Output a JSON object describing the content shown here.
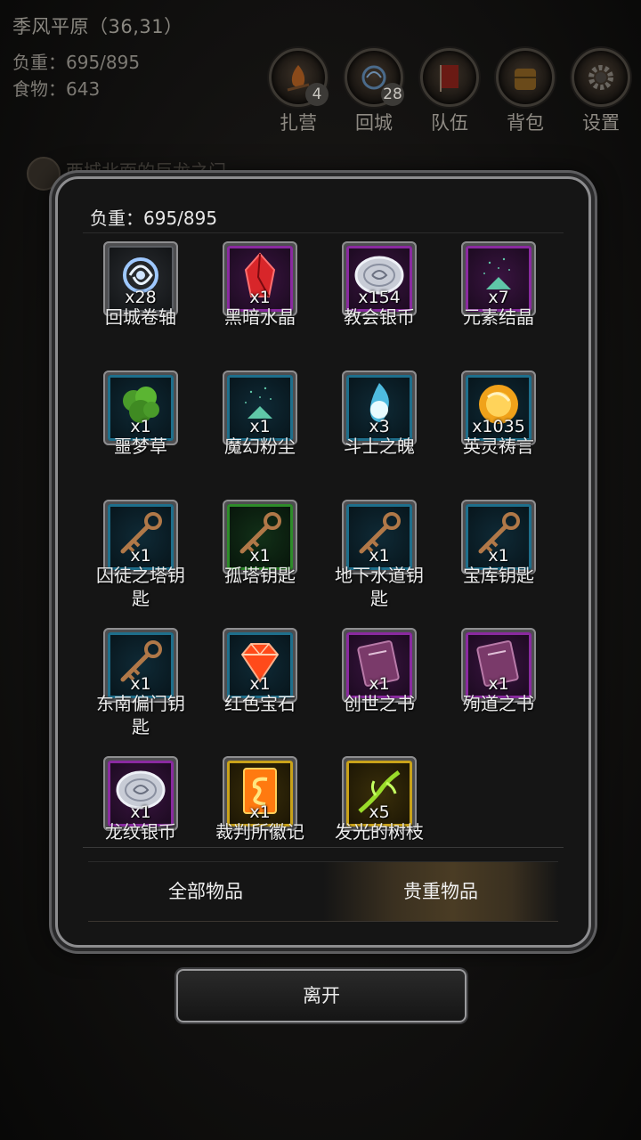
{
  "hud": {
    "location": "季风平原（36,31）",
    "load": "负重：695/895",
    "food": "食物：643",
    "buttons": [
      {
        "label": "扎营",
        "badge": "4",
        "icon": "campfire-icon"
      },
      {
        "label": "回城",
        "badge": "28",
        "icon": "portal-icon"
      },
      {
        "label": "队伍",
        "badge": "",
        "icon": "team-banner-icon"
      },
      {
        "label": "背包",
        "badge": "",
        "icon": "backpack-icon"
      },
      {
        "label": "设置",
        "badge": "",
        "icon": "gear-icon"
      }
    ],
    "background_quest": "西城北面的巨龙之门"
  },
  "modal": {
    "weight": "负重：695/895",
    "items": [
      {
        "name": "回城卷轴",
        "count": "x28",
        "quality": "gray",
        "icon": "swirl-scroll-icon",
        "color": "#9ec8ff"
      },
      {
        "name": "黑暗水晶",
        "count": "x1",
        "quality": "purple",
        "icon": "red-crystal-icon",
        "color": "#d8262a"
      },
      {
        "name": "教会银币",
        "count": "x154",
        "quality": "purple",
        "icon": "silver-coin-icon",
        "color": "#c8ccd6"
      },
      {
        "name": "元素结晶",
        "count": "x7",
        "quality": "purple",
        "icon": "crystal-dust-icon",
        "color": "#5fc7a8"
      },
      {
        "name": "噩梦草",
        "count": "x1",
        "quality": "blue",
        "icon": "herb-icon",
        "color": "#4a9b2a"
      },
      {
        "name": "魔幻粉尘",
        "count": "x1",
        "quality": "blue",
        "icon": "crystal-dust-icon",
        "color": "#5fc7a8"
      },
      {
        "name": "斗士之魄",
        "count": "x3",
        "quality": "blue",
        "icon": "spirit-flame-icon",
        "color": "#5ad6ff"
      },
      {
        "name": "英灵祷言",
        "count": "x1035",
        "quality": "blue",
        "icon": "golden-orb-icon",
        "color": "#f0a21a"
      },
      {
        "name": "囚徒之塔钥匙",
        "count": "x1",
        "quality": "blue",
        "icon": "key-icon",
        "color": "#b07848"
      },
      {
        "name": "孤塔钥匙",
        "count": "x1",
        "quality": "green",
        "icon": "key-icon",
        "color": "#b07848"
      },
      {
        "name": "地下水道钥匙",
        "count": "x1",
        "quality": "blue",
        "icon": "key-icon",
        "color": "#b07848"
      },
      {
        "name": "宝库钥匙",
        "count": "x1",
        "quality": "blue",
        "icon": "key-icon",
        "color": "#b07848"
      },
      {
        "name": "东南偏门钥匙",
        "count": "x1",
        "quality": "blue",
        "icon": "key-icon",
        "color": "#b07848"
      },
      {
        "name": "红色宝石",
        "count": "x1",
        "quality": "blue",
        "icon": "red-gem-icon",
        "color": "#ff4a1a"
      },
      {
        "name": "创世之书",
        "count": "x1",
        "quality": "purple",
        "icon": "book-icon",
        "color": "#7a3a6a"
      },
      {
        "name": "殉道之书",
        "count": "x1",
        "quality": "purple",
        "icon": "book-icon",
        "color": "#7a3a6a"
      },
      {
        "name": "龙纹银币",
        "count": "x1",
        "quality": "purple",
        "icon": "silver-coin-icon",
        "color": "#c8ccd6"
      },
      {
        "name": "裁判所徽记",
        "count": "x1",
        "quality": "gold",
        "icon": "emblem-icon",
        "color": "#ff7a10"
      },
      {
        "name": "发光的树枝",
        "count": "x5",
        "quality": "gold",
        "icon": "glowing-branch-icon",
        "color": "#9adc2a"
      }
    ],
    "tabs": [
      {
        "label": "全部物品",
        "active": false
      },
      {
        "label": "贵重物品",
        "active": true
      }
    ]
  },
  "leave_button": "离开"
}
